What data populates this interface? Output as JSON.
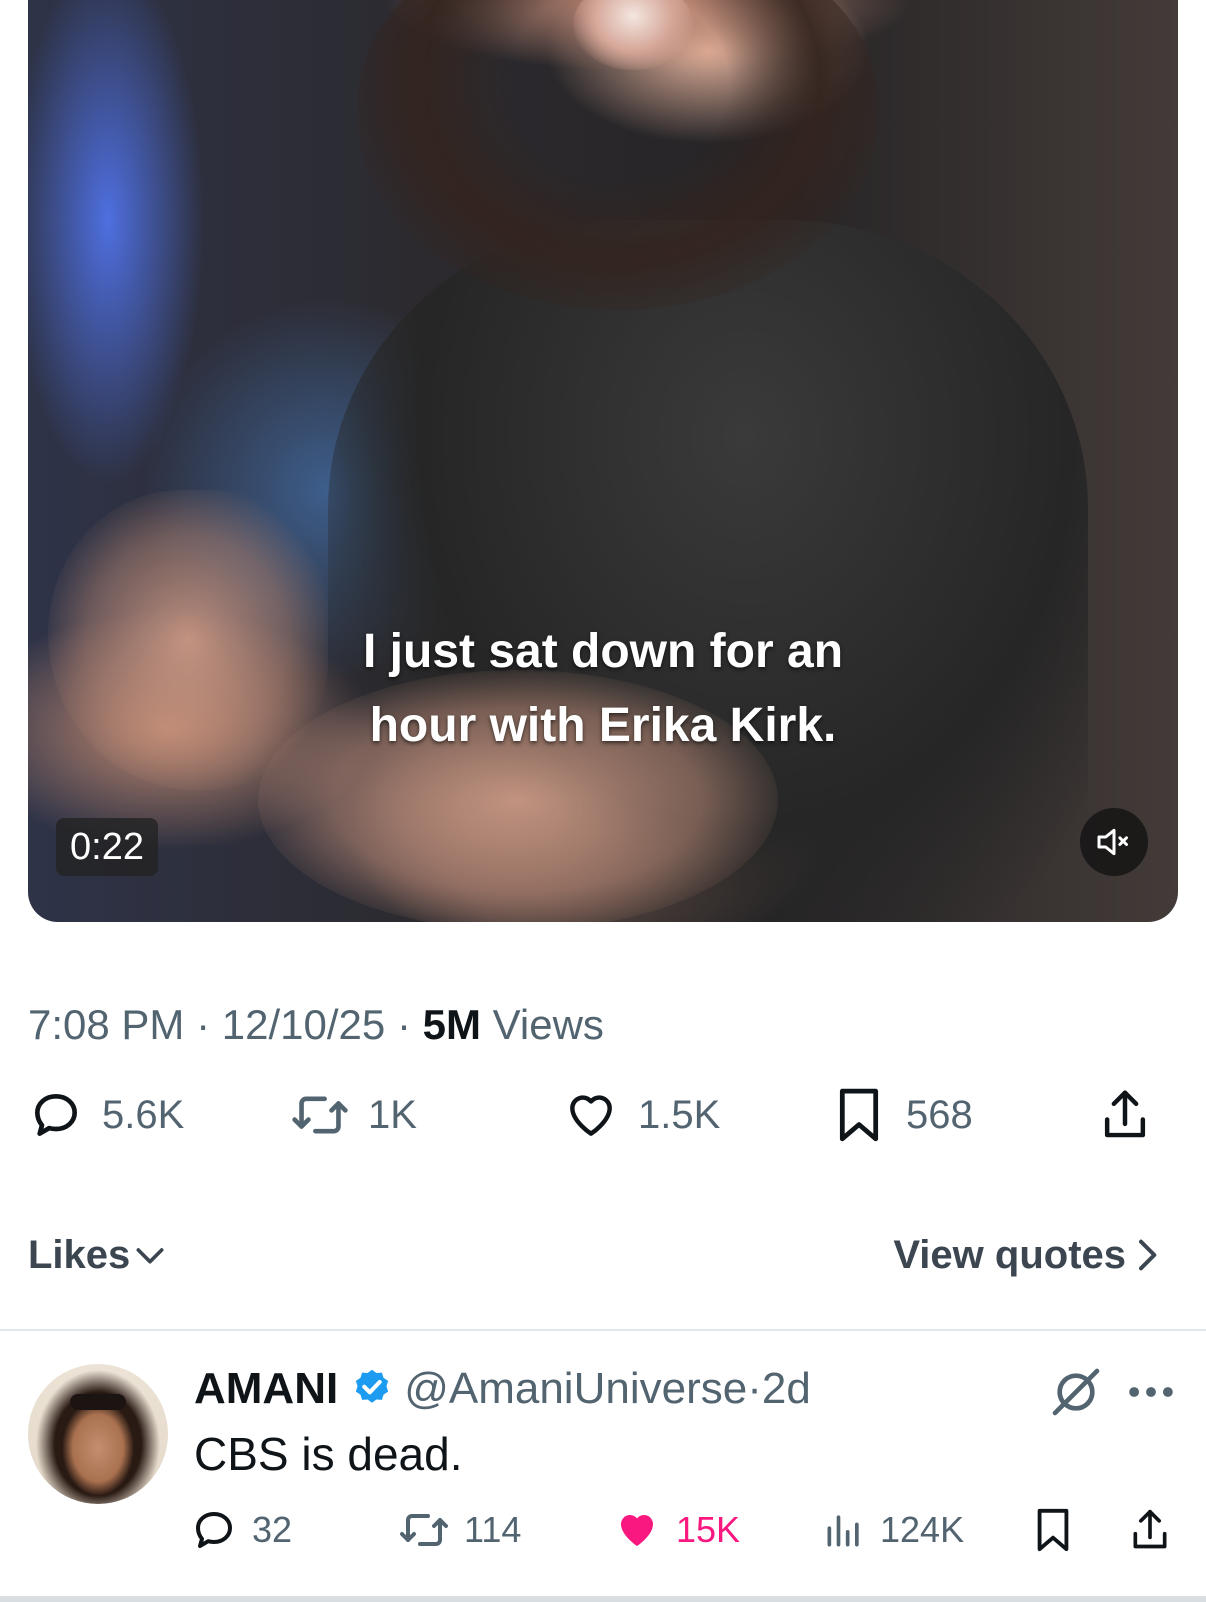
{
  "video": {
    "caption_line1": "I just sat down for an",
    "caption_line2": "hour with Erika Kirk.",
    "duration": "0:22",
    "mute_icon": "speaker-muted-icon"
  },
  "meta": {
    "time": "7:08 PM",
    "separator": "·",
    "date": "12/10/25",
    "views_count": "5M",
    "views_label": "Views"
  },
  "actions": {
    "replies": "5.6K",
    "reposts": "1K",
    "likes": "1.5K",
    "bookmarks": "568"
  },
  "footer": {
    "likes_label": "Likes",
    "quotes_label": "View quotes"
  },
  "reply": {
    "name": "AMANI",
    "handle": "@AmaniUniverse",
    "separator": "·",
    "age": "2d",
    "text": "CBS is dead.",
    "replies": "32",
    "reposts": "114",
    "likes": "15K",
    "views": "124K"
  },
  "colors": {
    "secondary_text": "#536471",
    "like_active": "#f91880",
    "verified": "#1d9bf0"
  }
}
